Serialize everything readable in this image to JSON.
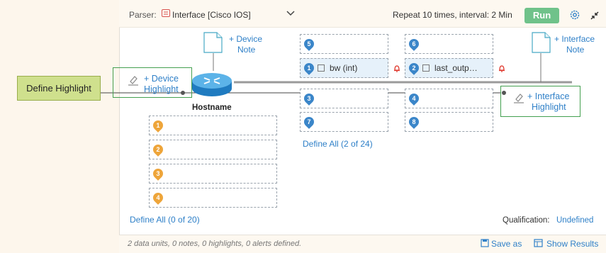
{
  "toolbar": {
    "parser_label": "Parser:",
    "parser_value": "Interface [Cisco IOS]",
    "repeat_text": "Repeat 10 times, interval: 2 Min",
    "run_label": "Run"
  },
  "callout": {
    "label": "Define Highlight"
  },
  "device": {
    "highlight_label_1": "+ Device",
    "highlight_label_2": "Highlight",
    "note_label_1": "+ Device",
    "note_label_2": "Note",
    "hostname": "Hostname",
    "slots": [
      "1",
      "2",
      "3",
      "4"
    ],
    "define_all": "Define All (0 of 20)"
  },
  "interface": {
    "note_label_1": "+ Interface",
    "note_label_2": "Note",
    "highlight_label_1": "+ Interface",
    "highlight_label_2": "Highlight",
    "slot5": "5",
    "slot6": "6",
    "slot1_num": "1",
    "slot1_text": "bw (int)",
    "slot2_num": "2",
    "slot2_text": "last_outp…",
    "slot3": "3",
    "slot4": "4",
    "slot7": "7",
    "slot8": "8",
    "define_all": "Define All (2 of 24)"
  },
  "qualification": {
    "label": "Qualification:",
    "value": "Undefined"
  },
  "status": {
    "summary": "2 data units, 0 notes, 0 highlights, 0 alerts defined.",
    "save_as": "Save as",
    "show_results": "Show Results"
  },
  "colors": {
    "run_green": "#6fc28a",
    "link_blue": "#2f80c8",
    "callout_green": "#cfe08d",
    "alert_red": "#e03a2f"
  }
}
